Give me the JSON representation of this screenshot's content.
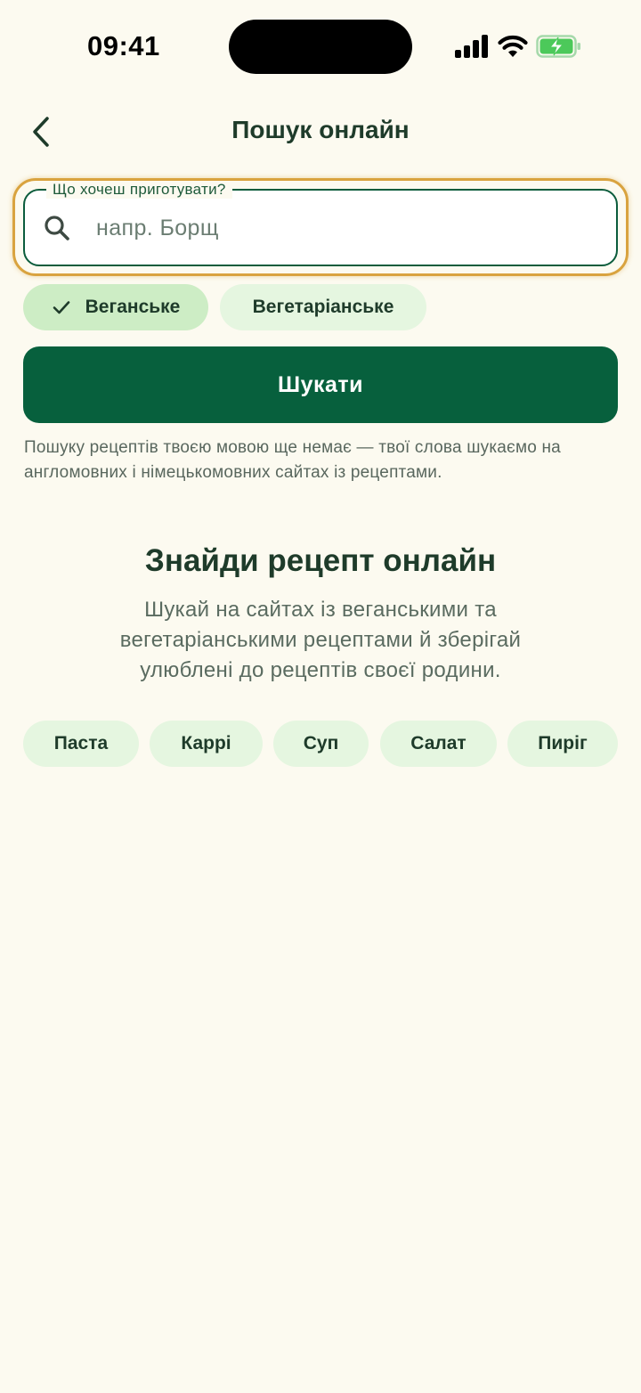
{
  "status_bar": {
    "time": "09:41"
  },
  "header": {
    "title": "Пошук онлайн"
  },
  "search": {
    "label": "Що хочеш приготувати?",
    "placeholder": "напр. Борщ",
    "value": ""
  },
  "filters": [
    {
      "label": "Веганське",
      "selected": true
    },
    {
      "label": "Вегетаріанське",
      "selected": false
    }
  ],
  "search_button": {
    "label": "Шукати"
  },
  "hint": "Пошуку рецептів твоєю мовою ще немає — твої слова шукаємо на англомовних і німецькомовних сайтах із рецептами.",
  "empty_state": {
    "title": "Знайди рецепт онлайн",
    "description": "Шукай на сайтах із веганськими та вегетаріанськими рецептами й зберігай улюблені до рецептів своєї родини."
  },
  "suggestions": [
    "Паста",
    "Каррі",
    "Суп",
    "Салат",
    "Пиріг"
  ],
  "colors": {
    "primary": "#07603d",
    "background": "#fcfaf0",
    "chip_selected": "#cdedc5",
    "chip": "#e5f6e0",
    "focus_ring": "#d9a33f",
    "battery": "#4cc95a"
  }
}
